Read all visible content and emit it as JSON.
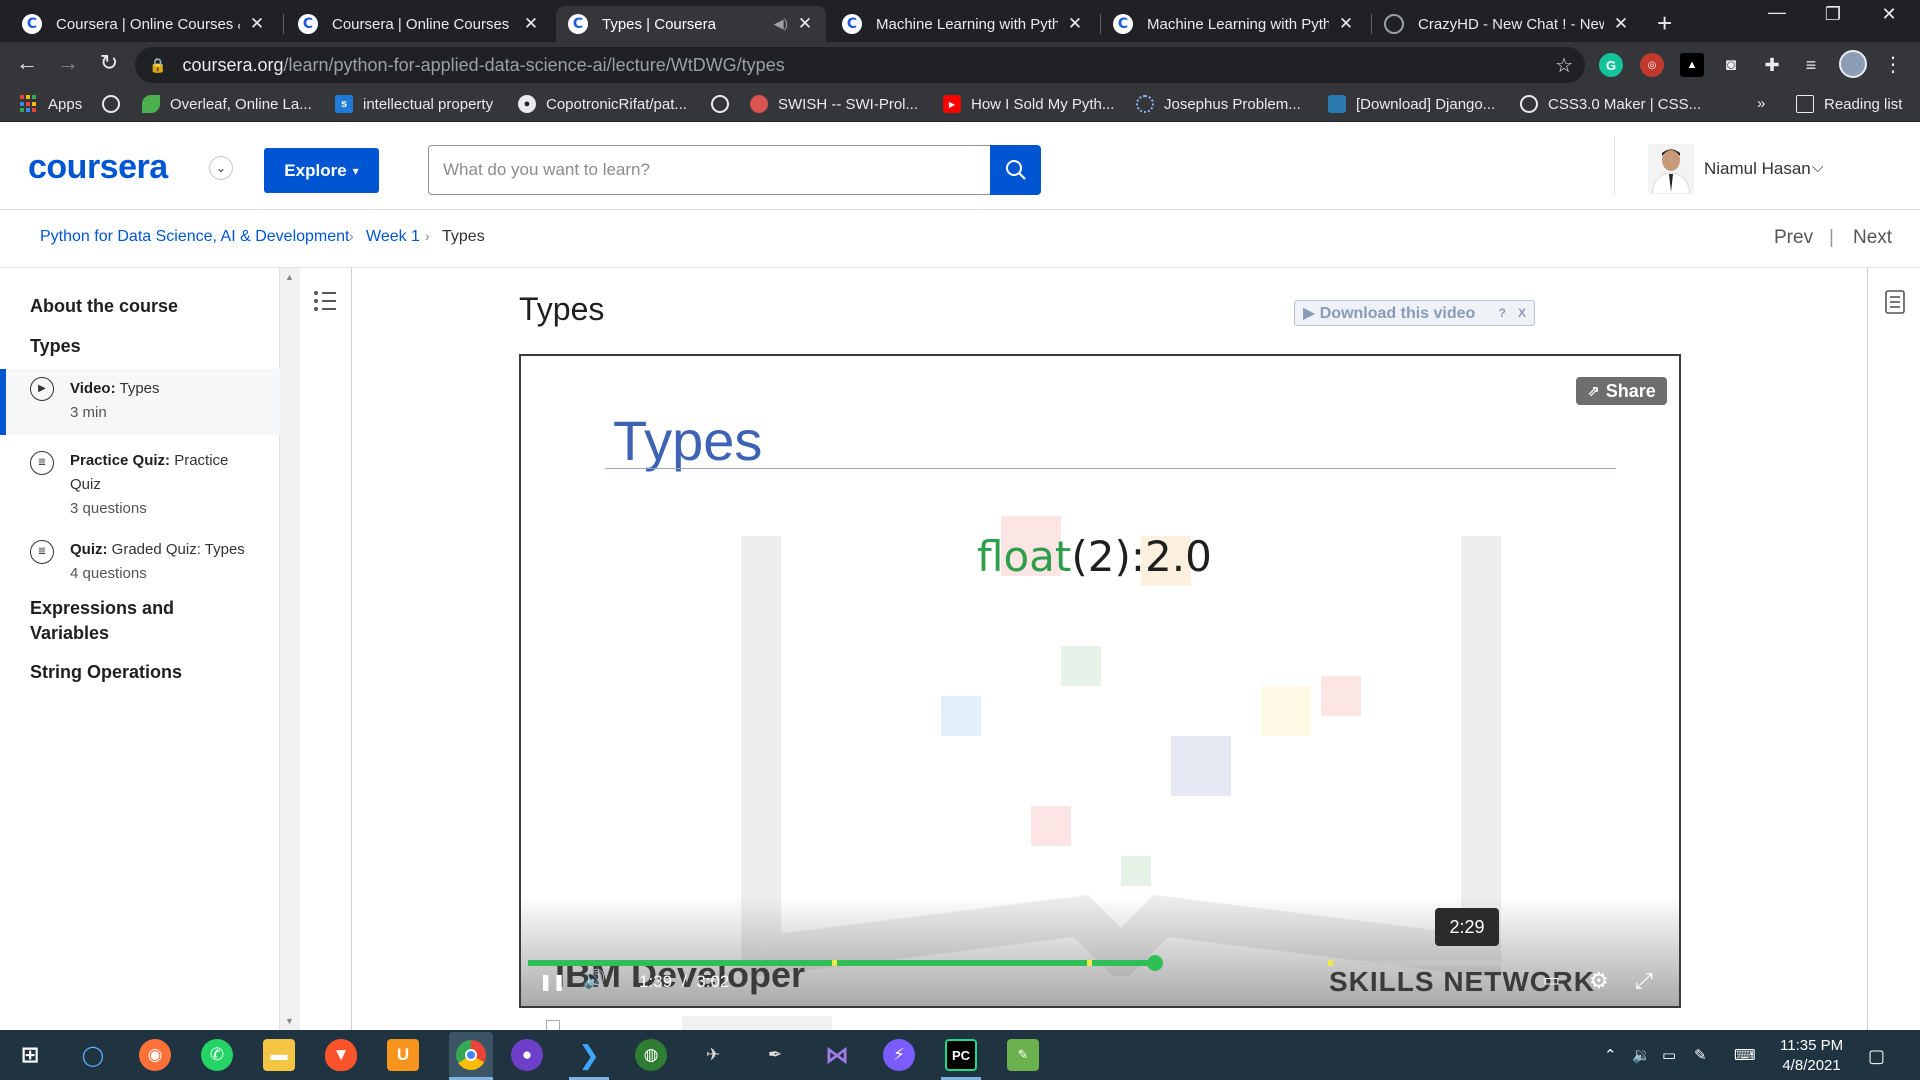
{
  "browser": {
    "tabs": [
      {
        "title": "Coursera | Online Courses & C",
        "favicon": "coursera-favicon",
        "active": false
      },
      {
        "title": "Coursera | Online Courses & C",
        "favicon": "coursera-favicon",
        "active": false
      },
      {
        "title": "Types | Coursera",
        "favicon": "coursera-favicon",
        "active": true
      },
      {
        "title": "Machine Learning with Pytho",
        "favicon": "coursera-favicon",
        "active": false
      },
      {
        "title": "Machine Learning with Pytho",
        "favicon": "coursera-favicon",
        "active": false
      },
      {
        "title": "CrazyHD - New Chat ! - New",
        "favicon": "globe-icon",
        "active": false
      }
    ],
    "url_host": "coursera.org",
    "url_path": "/learn/python-for-applied-data-science-ai/lecture/WtDWG/types",
    "bookmarks": [
      {
        "label": "Apps",
        "icon": "apps-grid-icon"
      },
      {
        "label": "",
        "icon": "globe-icon"
      },
      {
        "label": "Overleaf, Online La...",
        "icon": "overleaf-icon"
      },
      {
        "label": "intellectual property",
        "icon": "scribd-icon"
      },
      {
        "label": "CopotronicRifat/pat...",
        "icon": "github-icon"
      },
      {
        "label": "",
        "icon": "globe-icon"
      },
      {
        "label": "SWISH -- SWI-Prol...",
        "icon": "swish-icon"
      },
      {
        "label": "How I Sold My Pyth...",
        "icon": "youtube-icon"
      },
      {
        "label": "Josephus Problem...",
        "icon": "loading-icon"
      },
      {
        "label": "[Download] Django...",
        "icon": "site-icon"
      },
      {
        "label": "CSS3.0 Maker | CSS...",
        "icon": "globe-icon"
      }
    ],
    "bookmarks_overflow": "»",
    "reading_list": "Reading list"
  },
  "header": {
    "logo": "coursera",
    "explore_label": "Explore",
    "search_placeholder": "What do you want to learn?",
    "user_name": "Niamul Hasan"
  },
  "breadcrumb": {
    "items": [
      "Python for Data Science, AI & Development",
      "Week 1",
      "Types"
    ],
    "prev": "Prev",
    "separator": "|",
    "next": "Next"
  },
  "sidebar": {
    "about": "About the course",
    "section": "Types",
    "items": [
      {
        "kind": "Video:",
        "name": "Types",
        "meta": "3 min",
        "selected": true,
        "icon": "play-circle-icon"
      },
      {
        "kind": "Practice Quiz:",
        "name": "Practice Quiz",
        "meta": "3 questions",
        "selected": false,
        "icon": "quiz-icon"
      },
      {
        "kind": "Quiz:",
        "name": "Graded Quiz: Types",
        "meta": "4 questions",
        "selected": false,
        "icon": "quiz-icon"
      }
    ],
    "sections_after": [
      "Expressions and Variables",
      "String Operations"
    ]
  },
  "lecture": {
    "title": "Types",
    "download_label": "▶ Download this video",
    "download_help": "?",
    "download_close": "X"
  },
  "video": {
    "share_label": "Share",
    "slide_title": "Types",
    "code_fn": "float",
    "code_rest": "(2):2.0",
    "hover_time": "2:29",
    "current_time": "1:39",
    "time_sep": "/",
    "duration": "3:02",
    "progress_fraction": 0.547,
    "buffered_marks": [
      0.265,
      0.488,
      0.698
    ],
    "watermark_left": "IBM Developer",
    "watermark_right": "SKILLS NETWORK"
  },
  "taskbar": {
    "apps": [
      "start",
      "search",
      "firefox",
      "whatsapp",
      "file-explorer",
      "brave",
      "uc-browser",
      "chrome",
      "github-desktop",
      "vscode",
      "earth",
      "tool",
      "inkscape",
      "visual-studio",
      "messenger",
      "pycharm",
      "notepad"
    ],
    "time": "11:35 PM",
    "date": "4/8/2021"
  },
  "colors": {
    "coursera_blue": "#0056d2",
    "progress_green": "#2fbf55",
    "slide_title_blue": "#3e63b5"
  }
}
